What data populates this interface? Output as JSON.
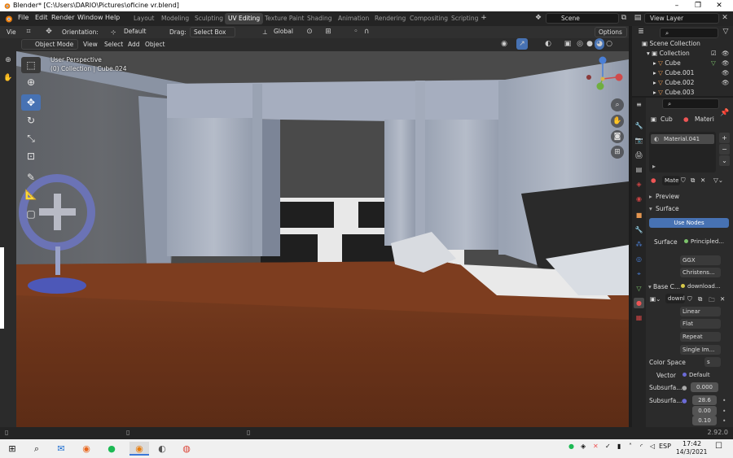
{
  "window": {
    "title": "Blender* [C:\\Users\\DARIO\\Pictures\\oficine vr.blend]",
    "controls": [
      "–",
      "❐",
      "✕"
    ]
  },
  "menu": {
    "items": [
      "File",
      "Edit",
      "Render",
      "Window",
      "Help"
    ]
  },
  "workspaces": [
    "Layout",
    "Modeling",
    "Sculpting",
    "UV Editing",
    "Texture Paint",
    "Shading",
    "Animation",
    "Rendering",
    "Compositing",
    "Scripting"
  ],
  "active_workspace": "UV Editing",
  "scene": {
    "name": "Scene",
    "view_layer": "View Layer"
  },
  "header": {
    "orientation_label": "Orientation:",
    "orientation_value": "Default",
    "drag_label": "Drag:",
    "drag_value": "Select Box",
    "transform": "Global",
    "options": "Options",
    "view_cut": "Vie"
  },
  "viewport_header": {
    "mode": "Object Mode",
    "menus": [
      "View",
      "Select",
      "Add",
      "Object"
    ]
  },
  "viewport": {
    "perspective": "User Perspective",
    "collection": "(0) Collection | Cube.024"
  },
  "outliner": {
    "root": "Scene Collection",
    "collection": "Collection",
    "objects": [
      "Cube",
      "Cube.001",
      "Cube.002",
      "Cube.003"
    ]
  },
  "properties": {
    "object_short": "Cub",
    "material_tab": "Materi",
    "material_slot": "Material.041",
    "material_field": "Mate",
    "panels": {
      "preview": "Preview",
      "surface": "Surface"
    },
    "use_nodes": "Use Nodes",
    "surface_label": "Surface",
    "surface_value": "Principled...",
    "distribution": "GGX",
    "subsurface_method": "Christens...",
    "base_color_label": "Base C...",
    "base_color_value": "download...",
    "image_name": "downl",
    "interpolation": "Linear",
    "projection": "Flat",
    "extension": "Repeat",
    "source": "Single Im...",
    "color_space_label": "Color Space",
    "color_space_value": "s",
    "vector_label": "Vector",
    "vector_value": "Default",
    "subsurface_label": "Subsurfa...",
    "subsurface_value": "0.000",
    "subsurface_radius_label": "Subsurfa...",
    "subsurface_radius": [
      "28.6",
      "0.00",
      "0.10"
    ]
  },
  "status": {
    "version": "2.92.0"
  },
  "taskbar": {
    "lang": "ESP",
    "time": "17:42",
    "date": "14/3/2021"
  },
  "colors": {
    "accent": "#4772b3",
    "object_orange": "#e3954f",
    "mesh_green": "#7cc36b"
  }
}
